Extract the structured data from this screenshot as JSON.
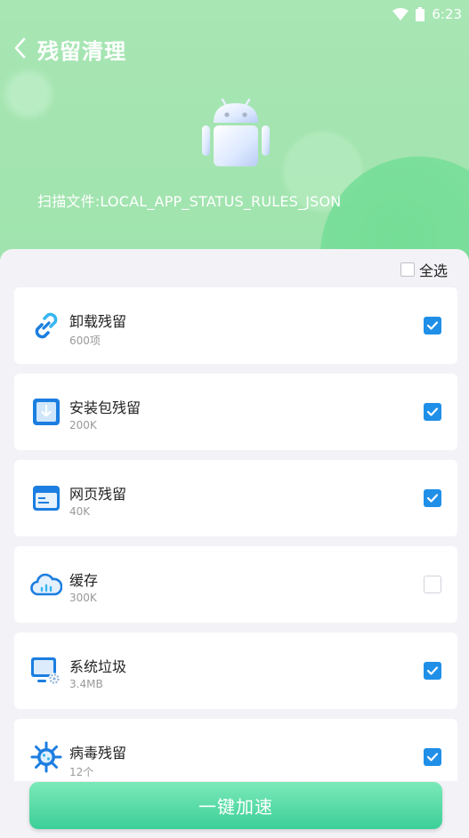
{
  "status_bar": {
    "time": "6:23",
    "wifi_icon": "wifi-icon",
    "battery_icon": "battery-icon"
  },
  "header": {
    "title": "残留清理",
    "back_icon": "chevron-left-icon",
    "robot_icon": "android-robot-icon",
    "scan_text": "扫描文件:LOCAL_APP_STATUS_RULES_JSON"
  },
  "select_all": {
    "label": "全选",
    "checked": false
  },
  "items": [
    {
      "name": "卸载残留",
      "size": "600项",
      "icon": "link-icon",
      "checked": true
    },
    {
      "name": "安装包残留",
      "size": "200K",
      "icon": "download-box-icon",
      "checked": true
    },
    {
      "name": "网页残留",
      "size": "40K",
      "icon": "browser-window-icon",
      "checked": true
    },
    {
      "name": "缓存",
      "size": "300K",
      "icon": "cloud-icon",
      "checked": false
    },
    {
      "name": "系统垃圾",
      "size": "3.4MB",
      "icon": "monitor-gear-icon",
      "checked": true
    },
    {
      "name": "病毒残留",
      "size": "12个",
      "icon": "virus-icon",
      "checked": true
    }
  ],
  "action_button": {
    "label": "一键加速"
  },
  "colors": {
    "header": "#a8e6b4",
    "accent": "#1f8fe8",
    "button": "#3ccf98"
  }
}
